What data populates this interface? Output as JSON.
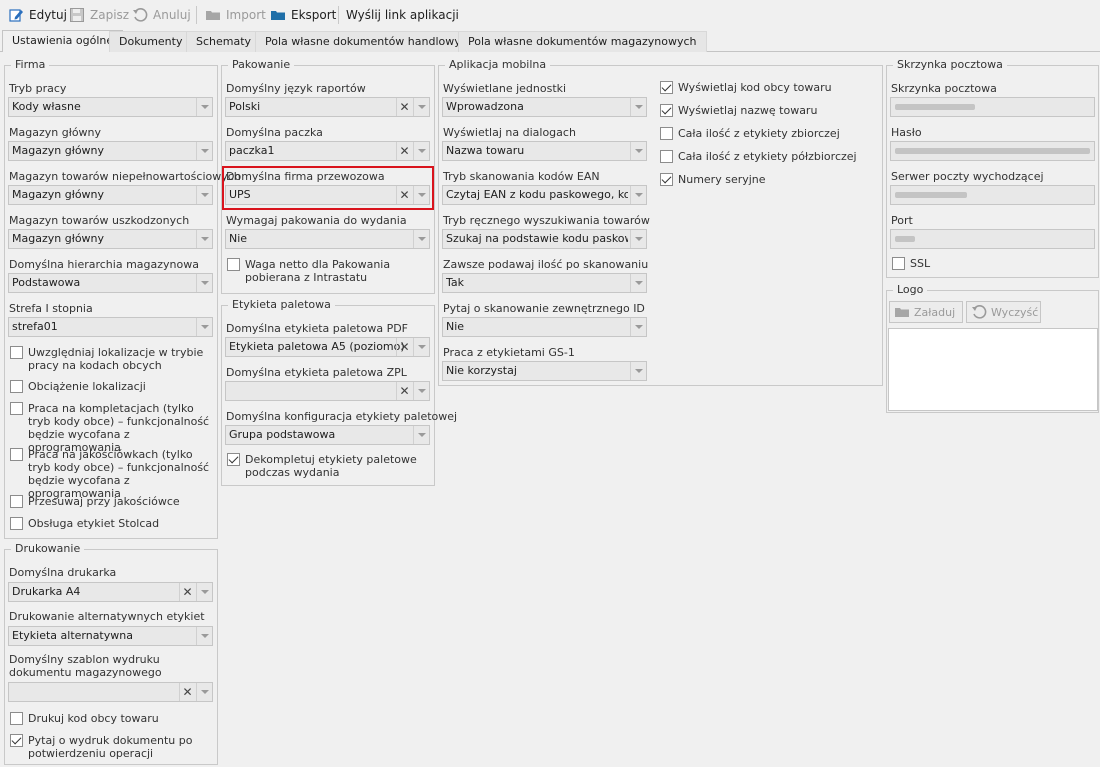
{
  "toolbar": {
    "edit": "Edytuj",
    "save": "Zapisz",
    "cancel": "Anuluj",
    "import": "Import",
    "export": "Eksport",
    "send_link": "Wyślij link aplikacji"
  },
  "tabs": [
    "Ustawienia ogólne",
    "Dokumenty",
    "Schematy",
    "Pola własne dokumentów handlowych",
    "Pola własne dokumentów magazynowych"
  ],
  "firma": {
    "title": "Firma",
    "tryb_pracy": {
      "label": "Tryb pracy",
      "value": "Kody własne"
    },
    "magazyn_glowny": {
      "label": "Magazyn główny",
      "value": "Magazyn główny"
    },
    "magazyn_niepelno": {
      "label": "Magazyn towarów niepełnowartościowych",
      "value": "Magazyn główny"
    },
    "magazyn_uszkodz": {
      "label": "Magazyn towarów uszkodzonych",
      "value": "Magazyn główny"
    },
    "hierarchia": {
      "label": "Domyślna hierarchia magazynowa",
      "value": "Podstawowa"
    },
    "strefa": {
      "label": "Strefa I stopnia",
      "value": "strefa01"
    },
    "checks": [
      {
        "label": "Uwzględniaj lokalizacje w trybie pracy na kodach obcych",
        "checked": false
      },
      {
        "label": "Obciążenie lokalizacji",
        "checked": false
      },
      {
        "label": "Praca na kompletacjach (tylko tryb kody obce) – funkcjonalność będzie wycofana z oprogramowania",
        "checked": false
      },
      {
        "label": "Praca na jakościówkach (tylko tryb kody obce) – funkcjonalność będzie wycofana z oprogramowania",
        "checked": false
      },
      {
        "label": "Przesuwaj przy jakościówce",
        "checked": false
      },
      {
        "label": "Obsługa etykiet Stolcad",
        "checked": false
      }
    ]
  },
  "drukowanie": {
    "title": "Drukowanie",
    "drukarka": {
      "label": "Domyślna drukarka",
      "value": "Drukarka A4"
    },
    "alternatywne": {
      "label": "Drukowanie alternatywnych etykiet",
      "value": "Etykieta alternatywna"
    },
    "szablon": {
      "label": "Domyślny szablon wydruku dokumentu magazynowego",
      "value": ""
    },
    "checks": [
      {
        "label": "Drukuj kod obcy towaru",
        "checked": false
      },
      {
        "label": "Pytaj o wydruk dokumentu po potwierdzeniu operacji",
        "checked": true
      }
    ]
  },
  "pakowanie": {
    "title": "Pakowanie",
    "jezyk": {
      "label": "Domyślny język raportów",
      "value": "Polski"
    },
    "paczka": {
      "label": "Domyślna paczka",
      "value": "paczka1"
    },
    "firma_przewozowa": {
      "label": "Domyślna firma przewozowa",
      "value": "UPS"
    },
    "wymagaj": {
      "label": "Wymagaj pakowania do wydania",
      "value": "Nie"
    },
    "waga_netto": {
      "label": "Waga netto dla Pakowania pobierana z Intrastatu",
      "checked": false
    }
  },
  "etykieta": {
    "title": "Etykieta paletowa",
    "pdf": {
      "label": "Domyślna etykieta paletowa PDF",
      "value": "Etykieta paletowa A5 (poziomo)"
    },
    "zpl": {
      "label": "Domyślna etykieta paletowa ZPL",
      "value": ""
    },
    "konfig": {
      "label": "Domyślna konfiguracja etykiety paletowej",
      "value": "Grupa podstawowa"
    },
    "dekompletuj": {
      "label": "Dekompletuj etykiety paletowe podczas wydania",
      "checked": true
    }
  },
  "mobilna": {
    "title": "Aplikacja mobilna",
    "jednostki": {
      "label": "Wyświetlane jednostki",
      "value": "Wprowadzona"
    },
    "dialogi": {
      "label": "Wyświetlaj na dialogach",
      "value": "Nazwa towaru"
    },
    "ean": {
      "label": "Tryb skanowania kodów EAN",
      "value": "Czytaj EAN z kodu paskowego, kod..."
    },
    "reczny": {
      "label": "Tryb ręcznego wyszukiwania towarów",
      "value": "Szukaj na podstawie kodu paskowe..."
    },
    "ilosc": {
      "label": "Zawsze podawaj ilość po skanowaniu",
      "value": "Tak"
    },
    "zewn_id": {
      "label": "Pytaj o skanowanie zewnętrznego ID",
      "value": "Nie"
    },
    "gs1": {
      "label": "Praca z etykietami GS-1",
      "value": "Nie korzystaj"
    },
    "checks": [
      {
        "label": "Wyświetlaj kod obcy towaru",
        "checked": true
      },
      {
        "label": "Wyświetlaj nazwę towaru",
        "checked": true
      },
      {
        "label": "Cała ilość z etykiety zbiorczej",
        "checked": false
      },
      {
        "label": "Cała ilość z etykiety półzbiorczej",
        "checked": false
      },
      {
        "label": "Numery seryjne",
        "checked": true
      }
    ]
  },
  "skrzynka": {
    "title": "Skrzynka pocztowa",
    "skrzynka_label": "Skrzynka pocztowa",
    "haslo_label": "Hasło",
    "serwer_label": "Serwer poczty wychodzącej",
    "port_label": "Port",
    "ssl": {
      "label": "SSL",
      "checked": false
    }
  },
  "logo": {
    "title": "Logo",
    "load": "Załaduj",
    "clear": "Wyczyść"
  }
}
